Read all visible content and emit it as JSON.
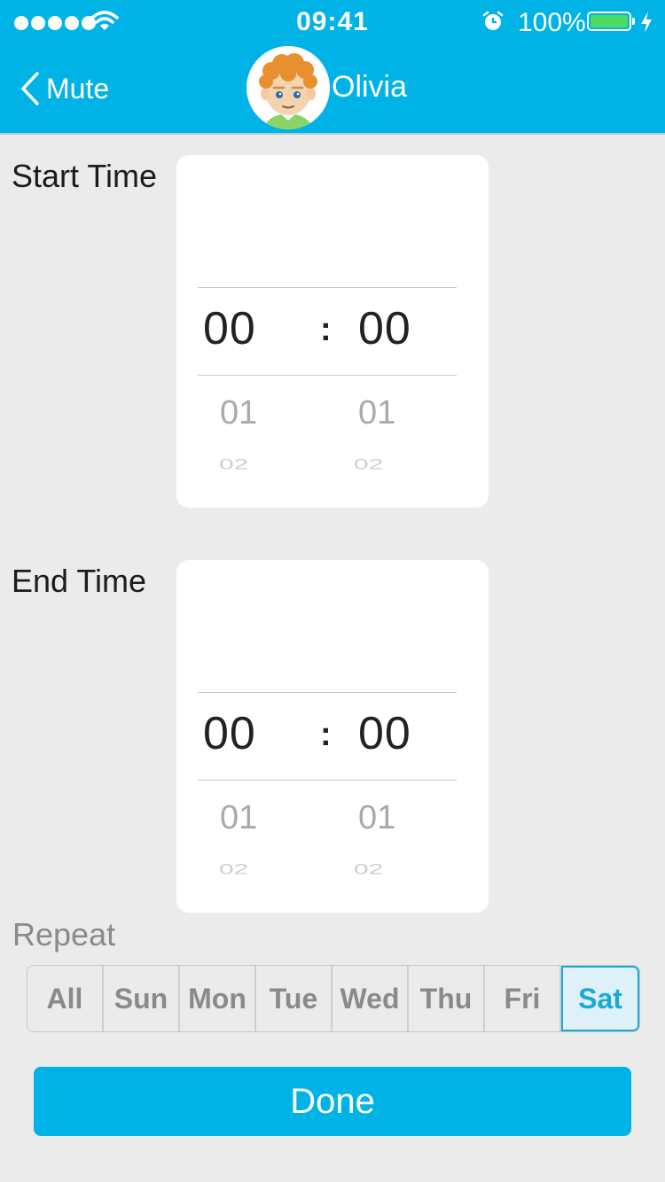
{
  "status_bar": {
    "time": "09:41",
    "battery_percent": "100%",
    "battery_level": 1.0,
    "signal_dots": 5,
    "icons": [
      "signal-icon",
      "wifi-icon",
      "alarm-icon",
      "battery-icon",
      "charging-bolt-icon"
    ]
  },
  "nav": {
    "back_label": "Mute",
    "contact_name": "Olivia",
    "back_icon": "chevron-left-icon",
    "avatar": "child-avatar"
  },
  "start_time": {
    "label": "Start Time",
    "hour": "00",
    "minute": "00",
    "separator": ":",
    "hour_next": "01",
    "minute_next": "01",
    "hour_next2": "02",
    "minute_next2": "02"
  },
  "end_time": {
    "label": "End Time",
    "hour": "00",
    "minute": "00",
    "separator": ":",
    "hour_next": "01",
    "minute_next": "01",
    "hour_next2": "02",
    "minute_next2": "02"
  },
  "repeat": {
    "label": "Repeat",
    "days": [
      "All",
      "Sun",
      "Mon",
      "Tue",
      "Wed",
      "Thu",
      "Fri",
      "Sat"
    ],
    "selected": "Sat"
  },
  "done_label": "Done",
  "colors": {
    "accent": "#00b3e6",
    "background": "#ebebeb",
    "selected_day_text": "#1aa9d6",
    "battery_green": "#4cd964"
  }
}
